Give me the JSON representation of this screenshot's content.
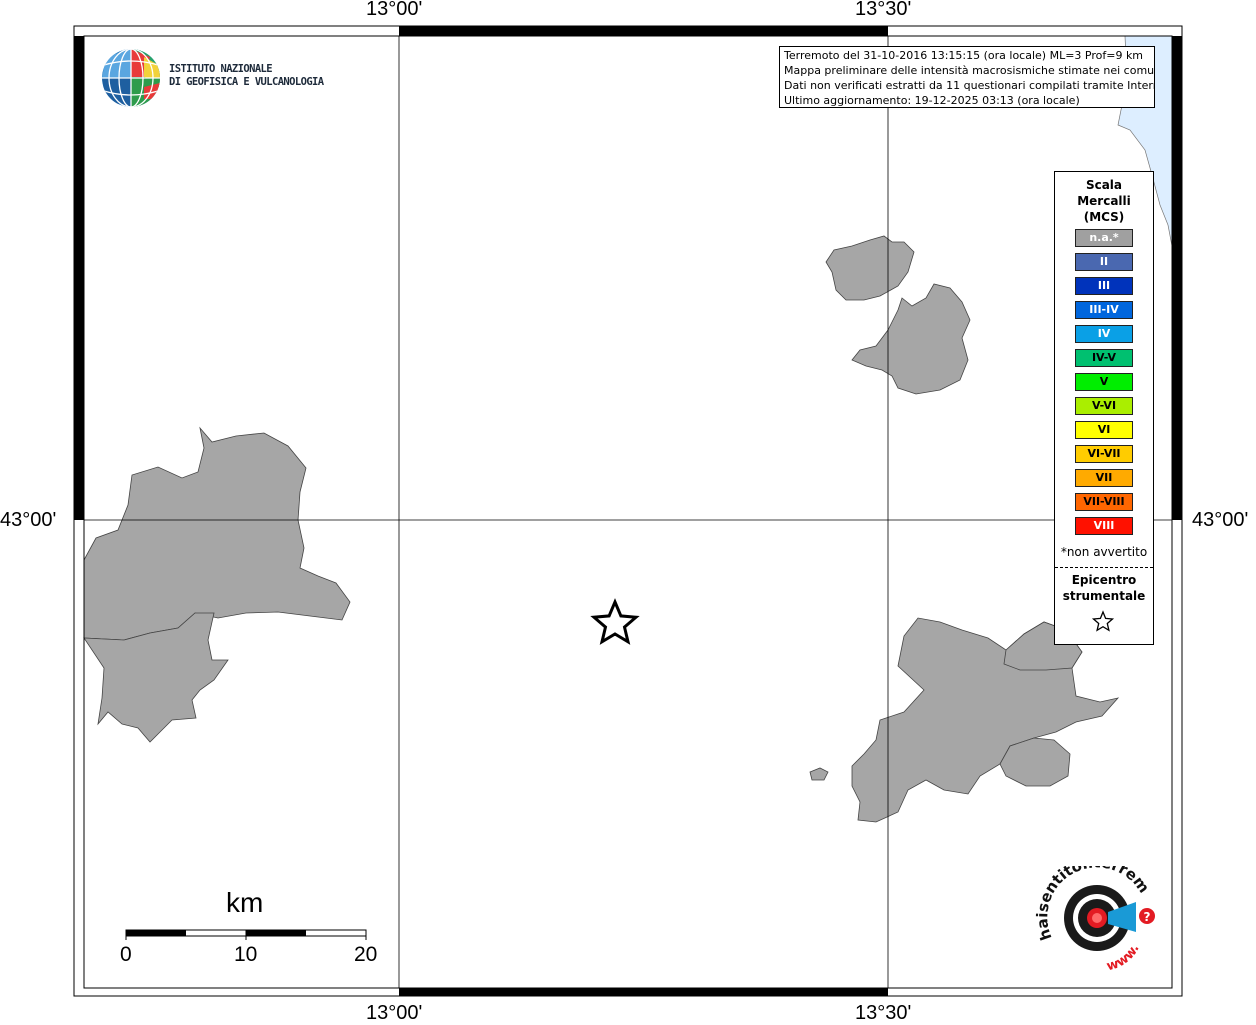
{
  "frame": {
    "top_labels": [
      "13°00'",
      "13°30'"
    ],
    "bottom_labels": [
      "13°00'",
      "13°30'"
    ],
    "left_label": "43°00'",
    "right_label": "43°00'"
  },
  "logo": {
    "line1": "ISTITUTO NAZIONALE",
    "line2": "DI GEOFISICA E VULCANOLOGIA"
  },
  "info": {
    "line1": "Terremoto del 31-10-2016 13:15:15 (ora locale) ML=3 Prof=9 km",
    "line2": "Mappa preliminare delle intensità macrosismiche stimate nei comuni",
    "line3": "Dati non verificati estratti da 11 questionari compilati tramite Internet.",
    "line4": "Ultimo aggiornamento: 19-12-2025 03:13 (ora locale)"
  },
  "legend": {
    "title": [
      "Scala",
      "Mercalli",
      "(MCS)"
    ],
    "items": [
      {
        "label": "n.a.*",
        "color": "#a0a0a0",
        "text_color": "#ffffff"
      },
      {
        "label": "II",
        "color": "#4a68b0",
        "text_color": "#ffffff"
      },
      {
        "label": "III",
        "color": "#0033bb",
        "text_color": "#ffffff"
      },
      {
        "label": "III-IV",
        "color": "#0066dd",
        "text_color": "#ffffff"
      },
      {
        "label": "IV",
        "color": "#0aa0e6",
        "text_color": "#ffffff"
      },
      {
        "label": "IV-V",
        "color": "#00c070",
        "text_color": "#000000"
      },
      {
        "label": "V",
        "color": "#00ee00",
        "text_color": "#000000"
      },
      {
        "label": "V-VI",
        "color": "#aaee00",
        "text_color": "#000000"
      },
      {
        "label": "VI",
        "color": "#ffff00",
        "text_color": "#000000"
      },
      {
        "label": "VI-VII",
        "color": "#ffcc00",
        "text_color": "#000000"
      },
      {
        "label": "VII",
        "color": "#ffaa00",
        "text_color": "#000000"
      },
      {
        "label": "VII-VIII",
        "color": "#ff6600",
        "text_color": "#000000"
      },
      {
        "label": "VIII",
        "color": "#ff1100",
        "text_color": "#ffffff"
      }
    ],
    "note": "*non avvertito",
    "epicentre_line1": "Epicentro",
    "epicentre_line2": "strumentale"
  },
  "scale_bar": {
    "unit": "km",
    "labels": [
      "0",
      "10",
      "20"
    ]
  },
  "colors": {
    "land": "#a6a6a6",
    "sea": "#ddeeff",
    "border": "#555555"
  },
  "hsi_logo": {
    "text_top": "haisentitoilterremoto.it",
    "text_bottom": "www."
  }
}
